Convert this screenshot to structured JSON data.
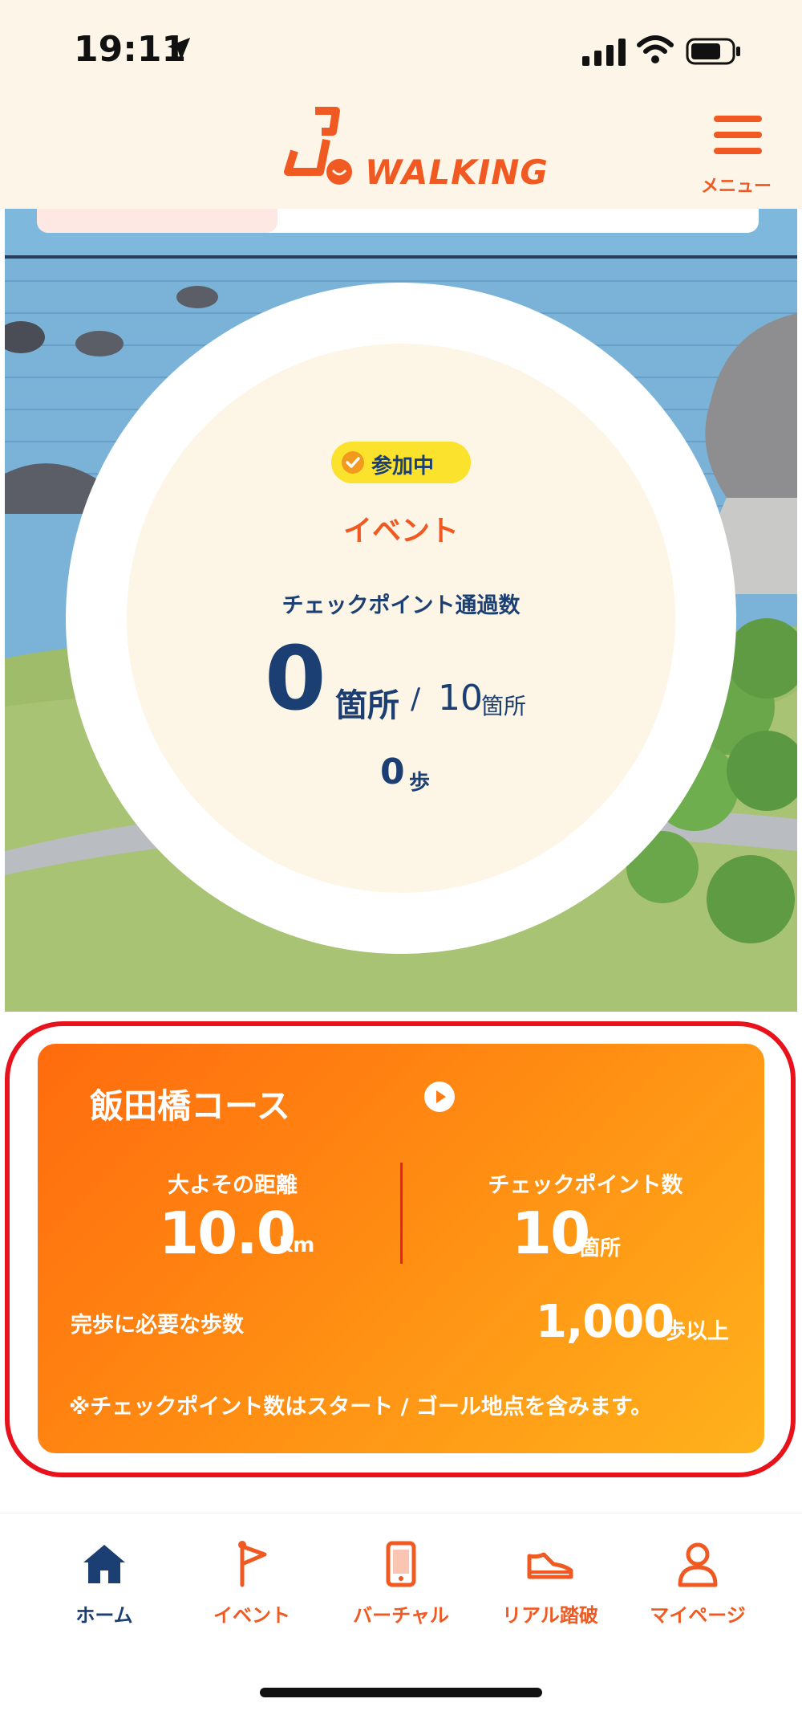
{
  "status_bar": {
    "time": "19:11"
  },
  "header": {
    "logo_text": "WALKING",
    "menu_label": "メニュー"
  },
  "progress_card": {
    "badge": "参加中",
    "event_title": "イベント",
    "checkpoint_label": "チェックポイント通過数",
    "passed_count": "0",
    "passed_unit": "箇所",
    "slash": "/",
    "total_count": "10",
    "total_unit": "箇所",
    "steps_value": "0",
    "steps_unit": "歩"
  },
  "course_card": {
    "title": "飯田橋コース",
    "distance_label": "大よその距離",
    "distance_value": "10.0",
    "distance_unit": "km",
    "checkpoints_label": "チェックポイント数",
    "checkpoints_value": "10",
    "checkpoints_unit": "箇所",
    "required_label": "完歩に必要な歩数",
    "required_value": "1,000",
    "required_unit": "歩以上",
    "note": "※チェックポイント数はスタート / ゴール地点を含みます。"
  },
  "bottom_nav": {
    "items": [
      {
        "label": "ホーム",
        "icon": "home-icon",
        "active": true
      },
      {
        "label": "イベント",
        "icon": "flag-icon",
        "active": false
      },
      {
        "label": "バーチャル",
        "icon": "smartphone-icon",
        "active": false
      },
      {
        "label": "リアル踏破",
        "icon": "sneaker-icon",
        "active": false
      },
      {
        "label": "マイページ",
        "icon": "user-icon",
        "active": false
      }
    ]
  },
  "colors": {
    "accent": "#f05a22",
    "navy": "#1c3f73",
    "badge_yellow": "#fbe22d",
    "highlight_red": "#e8121c"
  }
}
